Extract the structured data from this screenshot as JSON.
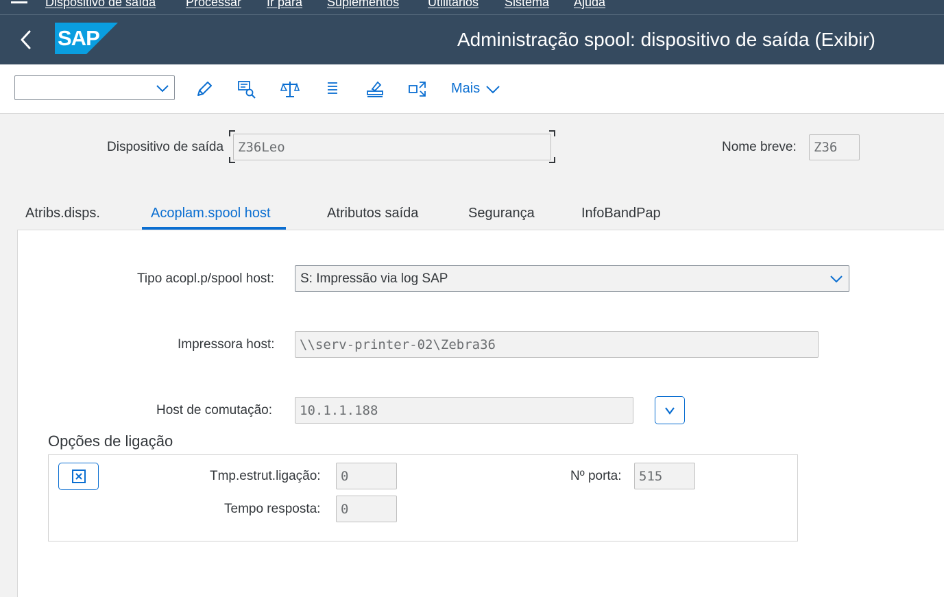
{
  "menu": {
    "items": [
      "Dispositivo de saída",
      "Processar",
      "Ir para",
      "Suplementos",
      "Utilitários",
      "Sistema",
      "Ajuda"
    ]
  },
  "header": {
    "logo_text": "SAP",
    "title": "Administração spool: dispositivo de saída (Exibir)"
  },
  "toolbar": {
    "select_value": "",
    "icons": [
      "edit-icon",
      "search-list-icon",
      "compare-icon",
      "list-icon",
      "stamp-icon",
      "exit-fullscreen-icon"
    ],
    "more_label": "Mais"
  },
  "device": {
    "label": "Dispositivo de saída",
    "value": "Z36Leo",
    "short_name_label": "Nome breve:",
    "short_name_value": "Z36"
  },
  "tabs": {
    "items": [
      "Atribs.disps.",
      "Acoplam.spool host",
      "Atributos saída",
      "Segurança",
      "InfoBandPap"
    ],
    "active_index": 1
  },
  "spool": {
    "type_label": "Tipo acopl.p/spool host:",
    "type_value": "S: Impressão via log SAP",
    "printer_label": "Impressora host:",
    "printer_value": "\\\\serv-printer-02\\Zebra36",
    "switch_host_label": "Host de comutação:",
    "switch_host_value": "10.1.1.188"
  },
  "connection": {
    "title": "Opções de ligação",
    "setup_time_label": "Tmp.estrut.ligação:",
    "setup_time_value": "0",
    "response_time_label": "Tempo resposta:",
    "response_time_value": "0",
    "port_label": "Nº porta:",
    "port_value": "515"
  },
  "colors": {
    "shell": "#354a5f",
    "accent": "#0a6ed1",
    "logo": "#0a9ee0"
  }
}
